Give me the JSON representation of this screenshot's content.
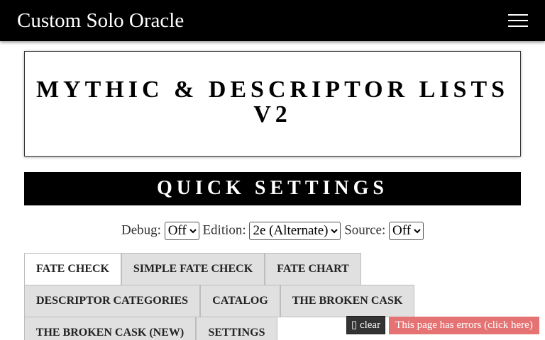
{
  "navbar": {
    "brand": "Custom Solo Oracle",
    "menu_icon": "hamburger-icon"
  },
  "title": "Mythic & Descriptor Lists v2",
  "quick_settings": {
    "heading": "QUICK SETTINGS",
    "debug_label": "Debug:",
    "debug_value": "Off",
    "edition_label": "Edition:",
    "edition_value": "2e (Alternate)",
    "source_label": "Source:",
    "source_value": "Off"
  },
  "tabs": [
    {
      "label": "Fate Check",
      "active": true
    },
    {
      "label": "Simple Fate Check",
      "active": false
    },
    {
      "label": "Fate Chart",
      "active": false
    },
    {
      "label": "Descriptor Categories",
      "active": false
    },
    {
      "label": "Catalog",
      "active": false
    },
    {
      "label": "The Broken Cask",
      "active": false
    },
    {
      "label": "The Broken Cask (New)",
      "active": false
    },
    {
      "label": "Settings",
      "active": false
    }
  ],
  "debug_bar": {
    "clear_icon": "missing-glyph-icon",
    "clear_label": "clear",
    "error_label": "This page has errors (click here)"
  }
}
